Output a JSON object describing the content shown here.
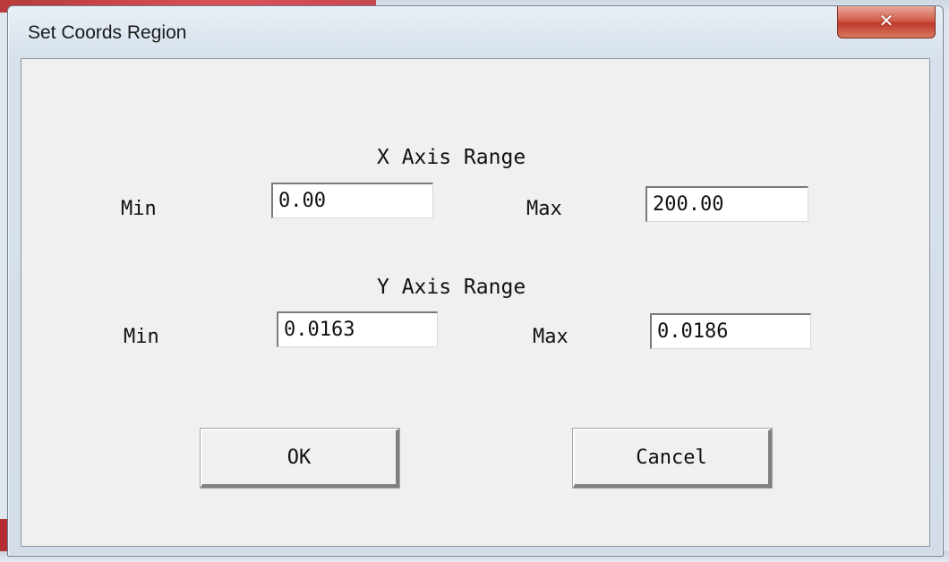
{
  "window": {
    "title": "Set Coords Region",
    "close_label": "✕"
  },
  "x_axis": {
    "heading": "X Axis Range",
    "min_label": "Min",
    "min_value": "0.00",
    "max_label": "Max",
    "max_value": "200.00"
  },
  "y_axis": {
    "heading": "Y Axis Range",
    "min_label": "Min",
    "min_value": "0.0163",
    "max_label": "Max",
    "max_value": "0.0186"
  },
  "buttons": {
    "ok": "OK",
    "cancel": "Cancel"
  }
}
